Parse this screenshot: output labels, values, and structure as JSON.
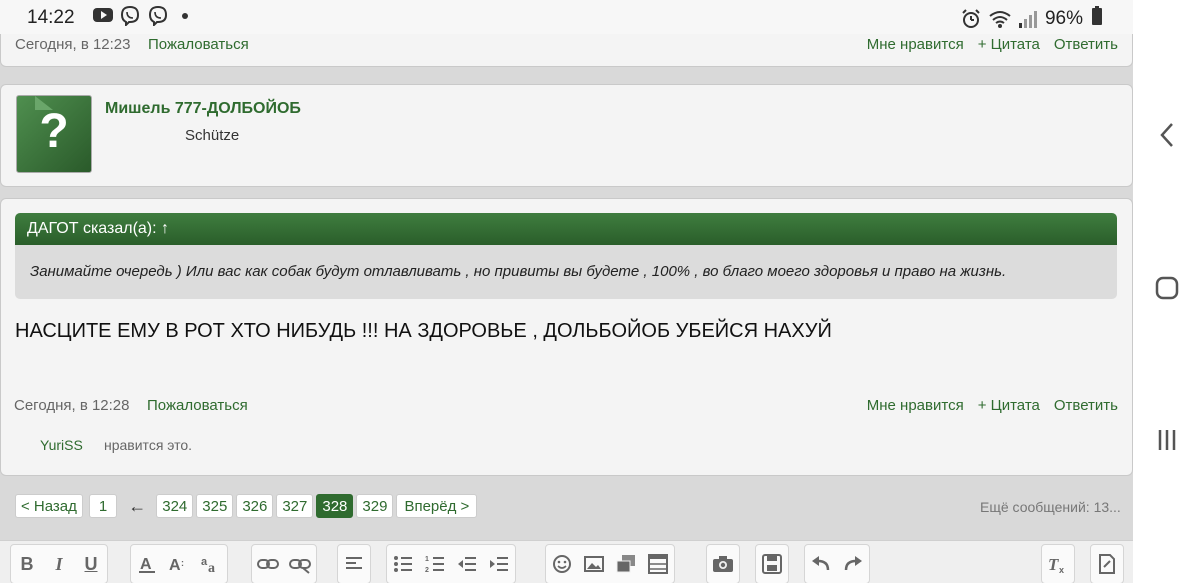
{
  "status": {
    "time": "14:22",
    "battery": "96%"
  },
  "prev_post": {
    "date": "Сегодня, в 12:23",
    "report": "Пожаловаться",
    "like": "Мне нравится",
    "quote": "+ Цитата",
    "reply": "Ответить"
  },
  "author": {
    "name": "Мишель 777-ДОЛБОЙОБ",
    "title": "Schütze",
    "avatar_glyph": "?"
  },
  "post": {
    "quote_header": "ДАГОТ сказал(а): ↑",
    "quote_text": "Занимайте очередь ) Или вас как собак будут отлавливать , но привиты вы будете , 100% , во благо моего здоровья и право на жизнь.",
    "text": "НАСЦИТЕ ЕМУ В РОТ ХТО НИБУДЬ !!! НА ЗДОРОВЬЕ , ДОЛЬБОЙОБ УБЕЙСЯ НАХУЙ",
    "date": "Сегодня, в 12:28",
    "report": "Пожаловаться",
    "like": "Мне нравится",
    "quote": "+ Цитата",
    "reply": "Ответить",
    "likes_user": "YuriSS",
    "likes_text": "нравится это."
  },
  "pagination": {
    "prev": "< Назад",
    "first": "1",
    "arrow": "←",
    "pages": [
      "324",
      "325",
      "326",
      "327",
      "328",
      "329"
    ],
    "current": "328",
    "next": "Вперёд >",
    "more": "Ещё сообщений: 13..."
  }
}
